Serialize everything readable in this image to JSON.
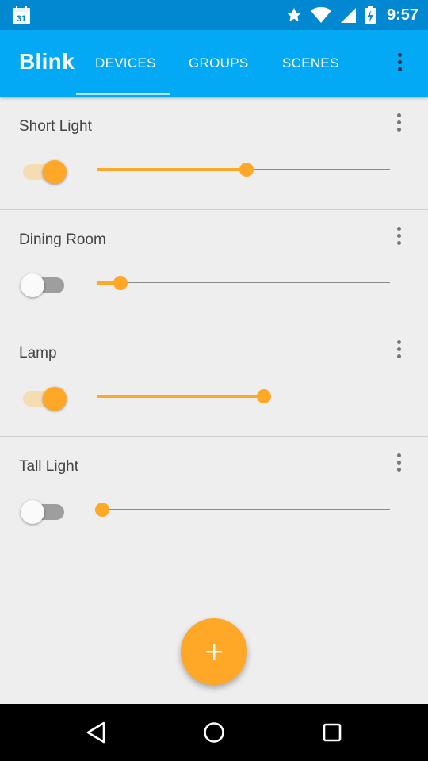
{
  "status_bar": {
    "calendar_day": "31",
    "time": "9:57",
    "icons": [
      "star-icon",
      "wifi-icon",
      "signal-icon",
      "battery-charging-icon"
    ]
  },
  "app_bar": {
    "title": "Blink",
    "tabs": [
      {
        "label": "DEVICES",
        "selected": true
      },
      {
        "label": "GROUPS",
        "selected": false
      },
      {
        "label": "SCENES",
        "selected": false
      }
    ],
    "overflow_icon": "more-vert-icon"
  },
  "devices": [
    {
      "name": "Short Light",
      "on": true,
      "brightness": 0.51
    },
    {
      "name": "Dining Room",
      "on": false,
      "brightness": 0.08
    },
    {
      "name": "Lamp",
      "on": true,
      "brightness": 0.57
    },
    {
      "name": "Tall Light",
      "on": false,
      "brightness": 0.02
    }
  ],
  "fab": {
    "icon": "add-icon"
  },
  "nav_bar": {
    "icons": [
      "back-icon",
      "home-icon",
      "recents-icon"
    ]
  },
  "colors": {
    "status_bar": "#0288d1",
    "app_bar": "#03a9f4",
    "accent": "#ffa726",
    "background": "#eeeeee"
  }
}
